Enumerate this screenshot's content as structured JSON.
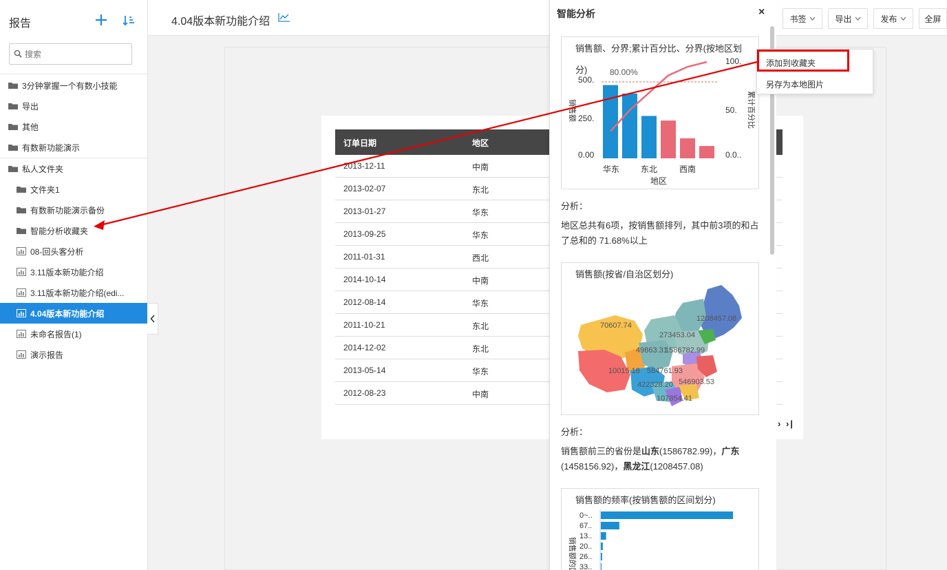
{
  "sidebar": {
    "title": "报告",
    "search_placeholder": "搜索",
    "items": [
      {
        "label": "3分钟掌握一个有数小技能",
        "type": "folder",
        "level": 0
      },
      {
        "label": "导出",
        "type": "folder",
        "level": 0
      },
      {
        "label": "其他",
        "type": "folder",
        "level": 0
      },
      {
        "label": "有数新功能演示",
        "type": "folder",
        "level": 0
      },
      {
        "label": "私人文件夹",
        "type": "folder-open",
        "level": 0
      },
      {
        "label": "文件夹1",
        "type": "folder",
        "level": 1
      },
      {
        "label": "有数新功能演示备份",
        "type": "folder",
        "level": 1
      },
      {
        "label": "智能分析收藏夹",
        "type": "folder",
        "level": 1
      },
      {
        "label": "08-回头客分析",
        "type": "report",
        "level": 1
      },
      {
        "label": "3.11版本新功能介绍",
        "type": "report",
        "level": 1
      },
      {
        "label": "3.11版本新功能介绍(edi...",
        "type": "report",
        "level": 1
      },
      {
        "label": "4.04版本新功能介绍",
        "type": "report",
        "level": 1,
        "active": true
      },
      {
        "label": "未命名报告(1)",
        "type": "report",
        "level": 1
      },
      {
        "label": "演示报告",
        "type": "report",
        "level": 1
      }
    ]
  },
  "header": {
    "title": "4.04版本新功能介绍",
    "buttons": [
      "书签",
      "导出",
      "发布",
      "全屏"
    ]
  },
  "table": {
    "columns": [
      "订单日期",
      "地区"
    ],
    "rows": [
      [
        "2013-12-11",
        "中南"
      ],
      [
        "2013-02-07",
        "东北"
      ],
      [
        "2013-01-27",
        "华东"
      ],
      [
        "2013-09-25",
        "华东"
      ],
      [
        "2011-01-31",
        "西北"
      ],
      [
        "2014-10-14",
        "中南"
      ],
      [
        "2012-08-14",
        "华东"
      ],
      [
        "2011-10-21",
        "东北"
      ],
      [
        "2014-12-02",
        "东北"
      ],
      [
        "2013-05-14",
        "华东"
      ],
      [
        "2012-08-23",
        "中南"
      ]
    ],
    "pager": "› ›|"
  },
  "panel": {
    "title": "智能分析",
    "close": "×",
    "card1": {
      "title_line1": "销售额、分界;累计百分比、分界(按地区划",
      "title_line2": "分)",
      "percent_label": "80.00%",
      "ylabel_left": "销售额",
      "ylabel_right": "累计百分比",
      "xlabel": "地区",
      "y_ticks_left": [
        "500.",
        "250.",
        "0.00"
      ],
      "y_ticks_right": [
        "100.",
        "50.",
        "0.0.."
      ],
      "x_ticks": [
        "华东",
        "东北",
        "西南"
      ]
    },
    "analysis1_label": "分析：",
    "analysis1_text": "地区总共有6项，按销售额排列，其中前3项的和占了总和的 71.68%以上",
    "card2": {
      "title": "销售额(按省/自治区划分)",
      "labels": [
        "1208457.08",
        "70607.74",
        "273453.04",
        "49863.31",
        "1586782.99",
        "10015.18",
        "584761.93",
        "422328.20",
        "546903.53",
        "107854.41"
      ]
    },
    "analysis2_label": "分析：",
    "analysis2_prefix": "销售额前三的省份是",
    "analysis2_p1": "山东",
    "analysis2_v1": "(1586782.99)，",
    "analysis2_p2": "广东",
    "analysis2_v2": "(1458156.92)，",
    "analysis2_p3": "黑龙江",
    "analysis2_v3": "(1208457.08)",
    "card3": {
      "title": "销售额的频率(按销售额的区间划分)",
      "ylabel": "销售额的区间",
      "y_ticks": [
        "0~..",
        "67..",
        "13..",
        "20..",
        "26..",
        "33.."
      ]
    }
  },
  "context_menu": {
    "items": [
      "添加到收藏夹",
      "另存为本地图片"
    ]
  },
  "chart_data": [
    {
      "type": "bar",
      "title": "销售额、分界;累计百分比、分界(按地区划分)",
      "xlabel": "地区",
      "ylabel": "销售额",
      "categories": [
        "华东",
        "",
        "东北",
        "",
        "西南",
        ""
      ],
      "series": [
        {
          "values": [
            475,
            420,
            275,
            245,
            130,
            80
          ],
          "colors": [
            "#1b8fd1",
            "#1b8fd1",
            "#1b8fd1",
            "#e86a76",
            "#e86a76",
            "#e86a76"
          ]
        }
      ],
      "line": {
        "name": "累计百分比",
        "values": [
          28,
          50,
          68,
          86,
          95,
          100
        ]
      },
      "ylim": [
        0,
        500
      ],
      "y2lim": [
        0,
        100
      ],
      "reference_line": 80
    },
    {
      "type": "bar",
      "orientation": "horizontal",
      "title": "销售额的频率(按销售额的区间划分)",
      "ylabel": "销售额的区间",
      "categories": [
        "0~..",
        "67..",
        "13..",
        "20..",
        "26..",
        "33.."
      ],
      "values": [
        100,
        14,
        4,
        1.5,
        1,
        0.5
      ]
    }
  ]
}
